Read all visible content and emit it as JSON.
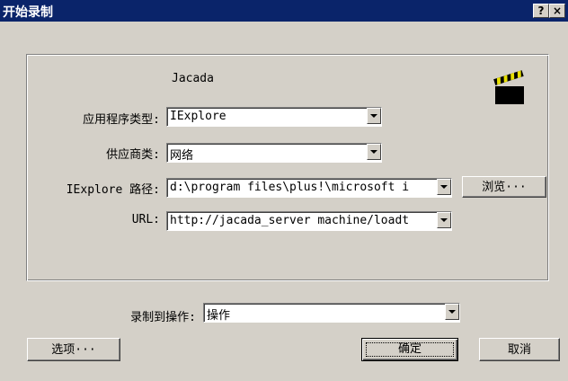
{
  "window": {
    "title": "开始录制",
    "help_label": "?",
    "close_label": "×"
  },
  "app": {
    "name": "Jacada",
    "icon": "clapperboard-icon"
  },
  "form": {
    "app_type": {
      "label": "应用程序类型:",
      "value": "IExplore"
    },
    "vendor": {
      "label": "供应商类:",
      "value": "网络"
    },
    "path": {
      "label": "IExplore 路径:",
      "value": "d:\\program files\\plus!\\microsoft i"
    },
    "browse_label": "浏览···",
    "url": {
      "label": "URL:",
      "value": "http://jacada_server machine/loadt"
    }
  },
  "record_to": {
    "label": "录制到操作:",
    "value": "操作"
  },
  "buttons": {
    "options": "选项···",
    "ok": "确定",
    "cancel": "取消"
  },
  "colors": {
    "titlebar": "#0a246a",
    "face": "#d4d0c8"
  }
}
